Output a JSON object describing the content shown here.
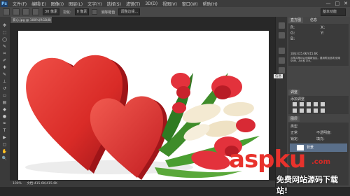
{
  "app": {
    "logo": "Ps"
  },
  "menu": {
    "items": [
      "文件(F)",
      "编辑(E)",
      "图像(I)",
      "图层(L)",
      "文字(Y)",
      "选择(S)",
      "滤镜(T)",
      "3D(D)",
      "视图(V)",
      "窗口(W)",
      "帮助(H)"
    ]
  },
  "window_buttons": {
    "minimize": "—",
    "restore": "□",
    "close": "✕"
  },
  "options": {
    "tool_size": "30 像素",
    "feather_label": "羽化:",
    "feather_value": "0 像素",
    "antialias_label": "消除锯齿",
    "refine_label": "调整边缘...",
    "workspace": "基本功能"
  },
  "document": {
    "tab_title": "爱心.jpg @ 100%(RGB/8)"
  },
  "status": {
    "zoom": "100%",
    "doc_info": "文档:415.6K/415.6K"
  },
  "tools": [
    {
      "icon": "move-icon",
      "glyph": "✥"
    },
    {
      "icon": "marquee-icon",
      "glyph": "⬚"
    },
    {
      "icon": "lasso-icon",
      "glyph": "◯"
    },
    {
      "icon": "quick-select-icon",
      "glyph": "✎"
    },
    {
      "icon": "crop-icon",
      "glyph": "⌗"
    },
    {
      "icon": "eyedropper-icon",
      "glyph": "✐"
    },
    {
      "icon": "healing-icon",
      "glyph": "✚"
    },
    {
      "icon": "brush-icon",
      "glyph": "✎"
    },
    {
      "icon": "stamp-icon",
      "glyph": "⊥"
    },
    {
      "icon": "history-brush-icon",
      "glyph": "↺"
    },
    {
      "icon": "eraser-icon",
      "glyph": "▭"
    },
    {
      "icon": "gradient-icon",
      "glyph": "▤"
    },
    {
      "icon": "blur-icon",
      "glyph": "◆"
    },
    {
      "icon": "dodge-icon",
      "glyph": "●"
    },
    {
      "icon": "pen-icon",
      "glyph": "✒"
    },
    {
      "icon": "type-icon",
      "glyph": "T"
    },
    {
      "icon": "path-select-icon",
      "glyph": "▶"
    },
    {
      "icon": "shape-icon",
      "glyph": "▢"
    },
    {
      "icon": "hand-icon",
      "glyph": "✋"
    },
    {
      "icon": "zoom-icon",
      "glyph": "🔍"
    }
  ],
  "panels": {
    "histogram_tab": "直方图",
    "info_tab": "信息",
    "info_r": "R:",
    "info_g": "G:",
    "info_b": "B:",
    "info_x": "X:",
    "info_y": "Y:",
    "doc_line": "文档:415.6K/415.6K",
    "hint_text": "点按并拖动以创建新选区。要用附加选项,使用 Shift、Alt 和 Ctrl。",
    "adjust_tab": "调整",
    "adjust_title": "添加调整",
    "layers_tab": "图层",
    "kind_label": "类型",
    "blend_mode": "正常",
    "opacity_label": "不透明度:",
    "lock_label": "锁定:",
    "fill_label": "填充:",
    "layer_name": "背景",
    "tooltip_label": "信息"
  },
  "watermark": {
    "brand": "aspku",
    "tld": ".com",
    "subtitle": "免费网站源码下载站!"
  },
  "colors": {
    "heart_red": "#d92b27",
    "tulip_red": "#e3323c",
    "tulip_cream": "#f4ead2",
    "leaf_green": "#3f8c2a"
  }
}
